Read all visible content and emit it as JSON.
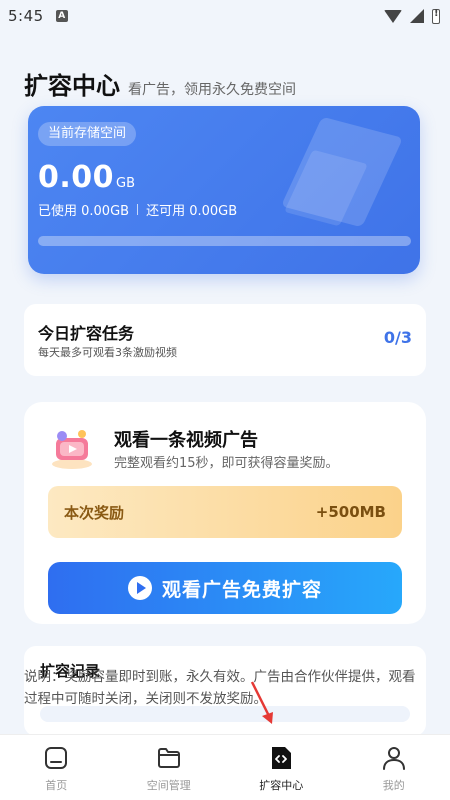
{
  "status_bar": {
    "time": "5:45",
    "notification_badge": "A"
  },
  "header": {
    "title": "扩容中心",
    "subtitle": "看广告，领用永久免费空间"
  },
  "storage": {
    "badge": "当前存储空间",
    "amount": "0.00",
    "unit": "GB",
    "used": "已使用 0.00GB",
    "available": "还可用 0.00GB",
    "progress": 0
  },
  "task": {
    "title": "今日扩容任务",
    "desc": "每天最多可观看3条激励视频",
    "count": "0/3"
  },
  "ad": {
    "title": "观看一条视频广告",
    "desc": "完整观看约15秒，即可获得容量奖励。",
    "reward_label": "本次奖励",
    "reward_value": "+500MB",
    "button_label": "观看广告免费扩容"
  },
  "record": {
    "title": "扩容记录"
  },
  "notice": "说明：奖励容量即时到账，永久有效。广告由合作伙伴提供，观看过程中可随时关闭，关闭则不发放奖励。",
  "tabs": [
    {
      "label": "首页",
      "icon": "home-icon"
    },
    {
      "label": "空间管理",
      "icon": "folder-icon"
    },
    {
      "label": "扩容中心",
      "icon": "code-file-icon",
      "active": true
    },
    {
      "label": "我的",
      "icon": "user-icon"
    }
  ],
  "colors": {
    "primary": "#3f73e8",
    "reward_bg": "#fbd28a",
    "button_start": "#2f6ef0",
    "button_end": "#27a8fb"
  }
}
